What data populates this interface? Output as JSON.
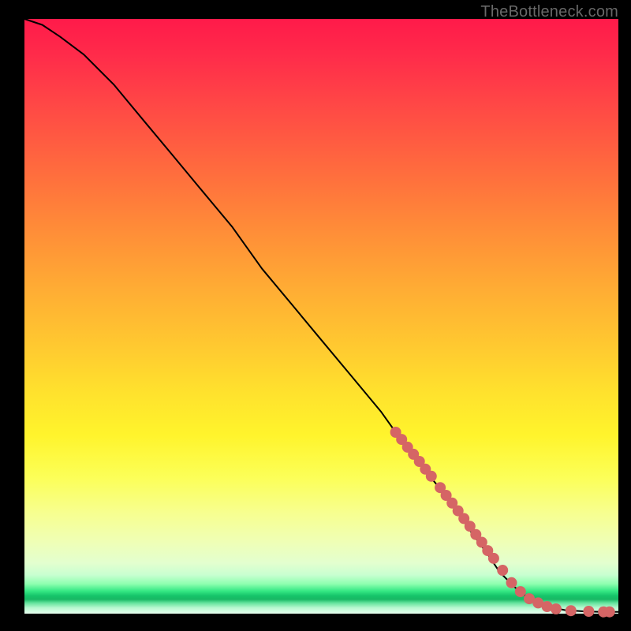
{
  "watermark": "TheBottleneck.com",
  "chart_data": {
    "type": "line",
    "title": "",
    "xlabel": "",
    "ylabel": "",
    "xlim": [
      0,
      100
    ],
    "ylim": [
      0,
      100
    ],
    "grid": false,
    "series": [
      {
        "name": "curve",
        "x": [
          0,
          3,
          6,
          10,
          15,
          20,
          25,
          30,
          35,
          40,
          45,
          50,
          55,
          60,
          65,
          70,
          73,
          75,
          78,
          80,
          82.5,
          85,
          88,
          91,
          94,
          97,
          100
        ],
        "y": [
          100,
          99,
          97,
          94,
          89,
          83,
          77,
          71,
          65,
          58,
          52,
          46,
          40,
          34,
          27,
          21,
          17,
          14,
          10,
          7,
          4.5,
          2.5,
          1.2,
          0.6,
          0.4,
          0.3,
          0.3
        ]
      },
      {
        "name": "highlight-dots",
        "x": [
          62.5,
          63.5,
          64.5,
          65.5,
          66.5,
          67.5,
          68.5,
          70.0,
          71.0,
          72.0,
          73.0,
          74.0,
          75.0,
          76.0,
          77.0,
          78.0,
          79.0,
          80.5,
          82.0,
          83.5,
          85.0,
          86.5,
          88.0,
          89.5,
          92.0,
          95.0,
          97.5,
          98.5
        ],
        "y": [
          30.5,
          29.3,
          28.0,
          26.8,
          25.6,
          24.3,
          23.1,
          21.2,
          19.9,
          18.6,
          17.3,
          16.0,
          14.7,
          13.3,
          12.0,
          10.6,
          9.3,
          7.3,
          5.2,
          3.7,
          2.5,
          1.8,
          1.2,
          0.8,
          0.5,
          0.4,
          0.3,
          0.3
        ]
      }
    ],
    "colors": {
      "curve": "#000000",
      "dots": "#d56565"
    }
  }
}
